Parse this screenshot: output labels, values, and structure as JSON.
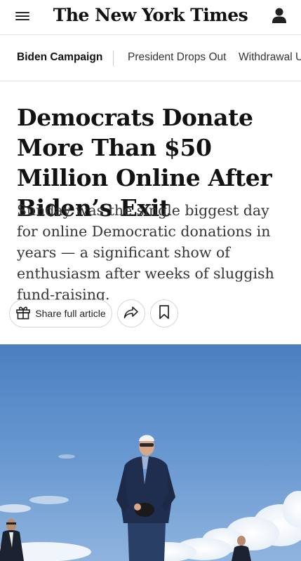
{
  "header": {
    "masthead": "The New York Times",
    "menu_icon": "hamburger-menu-icon",
    "account_icon": "user-account-icon"
  },
  "topic_nav": {
    "items": [
      "Biden Campaign",
      "President Drops Out",
      "Withdrawal U"
    ]
  },
  "article": {
    "headline": "Democrats Donate More Than $50 Million Online After Biden’s Exit",
    "summary": "Sunday was the single biggest day for online Democratic donations in years — a significant show of enthusiasm after weeks of sluggish fund-raising."
  },
  "actions": {
    "share_label": "Share full article",
    "gift_icon": "gift-icon",
    "forward_icon": "share-arrow-icon",
    "bookmark_icon": "bookmark-icon"
  },
  "colors": {
    "text": "#121212",
    "summary_text": "#363636",
    "divider": "#e2e2e2",
    "sky": "#4f86c6"
  }
}
